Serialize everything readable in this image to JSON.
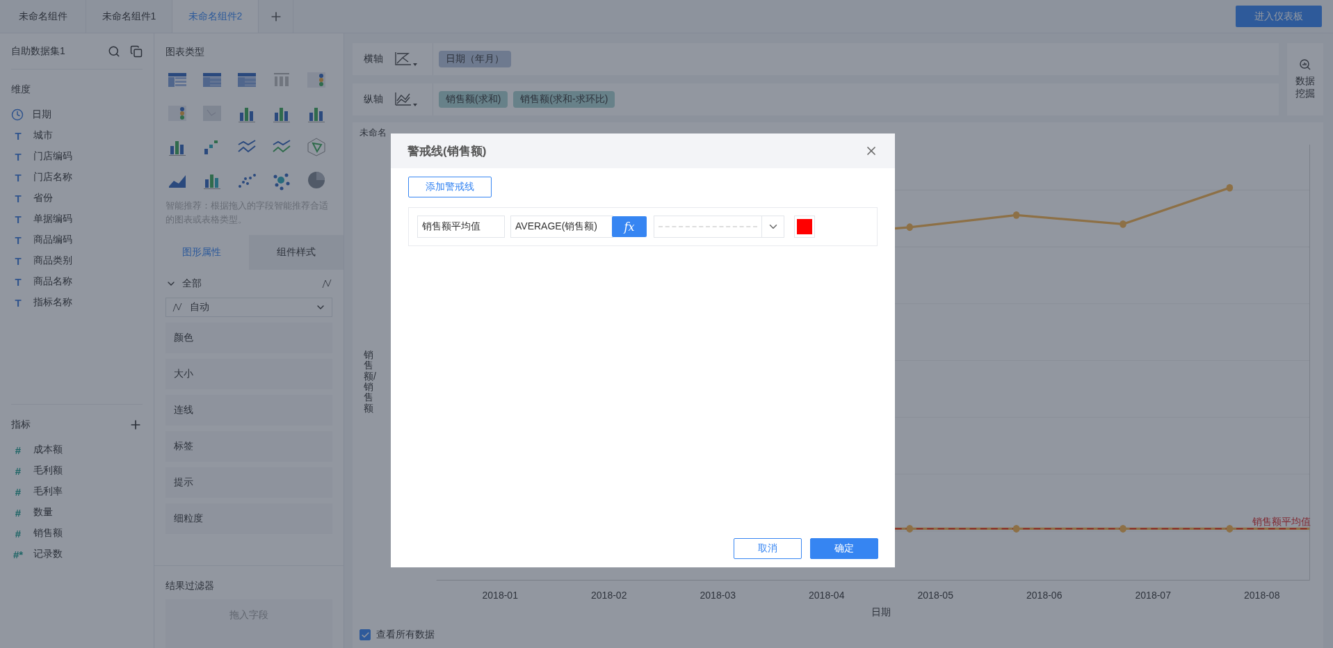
{
  "tabs": [
    {
      "label": "未命名组件",
      "selected": false
    },
    {
      "label": "未命名组件1",
      "selected": false
    },
    {
      "label": "未命名组件2",
      "selected": true
    }
  ],
  "enter_dashboard_button": "进入仪表板",
  "dataset": {
    "name": "自助数据集1"
  },
  "dimensions": {
    "title": "维度",
    "items": [
      {
        "kind": "date",
        "name": "日期"
      },
      {
        "kind": "text",
        "icon": "T",
        "name": "城市"
      },
      {
        "kind": "text",
        "icon": "T",
        "name": "门店编码"
      },
      {
        "kind": "text",
        "icon": "T",
        "name": "门店名称"
      },
      {
        "kind": "text",
        "icon": "T",
        "name": "省份"
      },
      {
        "kind": "text",
        "icon": "T",
        "name": "单据编码"
      },
      {
        "kind": "text",
        "icon": "T",
        "name": "商品编码"
      },
      {
        "kind": "text",
        "icon": "T",
        "name": "商品类别"
      },
      {
        "kind": "text",
        "icon": "T",
        "name": "商品名称"
      },
      {
        "kind": "text",
        "icon": "T",
        "name": "指标名称"
      }
    ]
  },
  "measures": {
    "title": "指标",
    "items": [
      {
        "icon": "#",
        "name": "成本额"
      },
      {
        "icon": "#",
        "name": "毛利额"
      },
      {
        "icon": "#",
        "name": "毛利率"
      },
      {
        "icon": "#",
        "name": "数量"
      },
      {
        "icon": "#",
        "name": "销售额"
      },
      {
        "icon": "#*",
        "name": "记录数"
      }
    ]
  },
  "chart_types": {
    "title": "图表类型",
    "hint": "智能推荐：根据拖入的字段智能推荐合适的图表或表格类型。"
  },
  "property_tabs": [
    {
      "label": "图形属性",
      "selected": true
    },
    {
      "label": "组件样式",
      "selected": false
    }
  ],
  "properties": {
    "group": "全部",
    "expanded": true,
    "mark_type": "自动",
    "rows": [
      "颜色",
      "大小",
      "连线",
      "标签",
      "提示",
      "细粒度"
    ]
  },
  "result_filter": {
    "title": "结果过滤器",
    "placeholder": "拖入字段"
  },
  "axes": [
    {
      "label": "横轴",
      "fields": [
        {
          "kind": "dimension",
          "name": "日期（年月）"
        }
      ]
    },
    {
      "label": "纵轴",
      "fields": [
        {
          "kind": "measure",
          "name": "销售额(求和)"
        },
        {
          "kind": "measure",
          "name": "销售额(求和-求环比)"
        }
      ]
    }
  ],
  "data_mining_button": "数据挖掘",
  "chart": {
    "title": "未命名",
    "y_title": "销售额/销售额",
    "x_title": "日期",
    "x_labels": [
      "2018-01",
      "2018-02",
      "2018-03",
      "2018-04",
      "2018-05",
      "2018-06",
      "2018-07",
      "2018-08"
    ],
    "warning_label": "销售额平均值"
  },
  "view_all": {
    "label": "查看所有数据",
    "checked": true
  },
  "dialog": {
    "title": "警戒线(销售额)",
    "add_button": "添加警戒线",
    "lines": [
      {
        "name": "销售额平均值",
        "formula": "AVERAGE(销售额)",
        "formula_button": "fx",
        "color": "#ff0000"
      }
    ],
    "cancel_button": "取消",
    "ok_button": "确定"
  }
}
